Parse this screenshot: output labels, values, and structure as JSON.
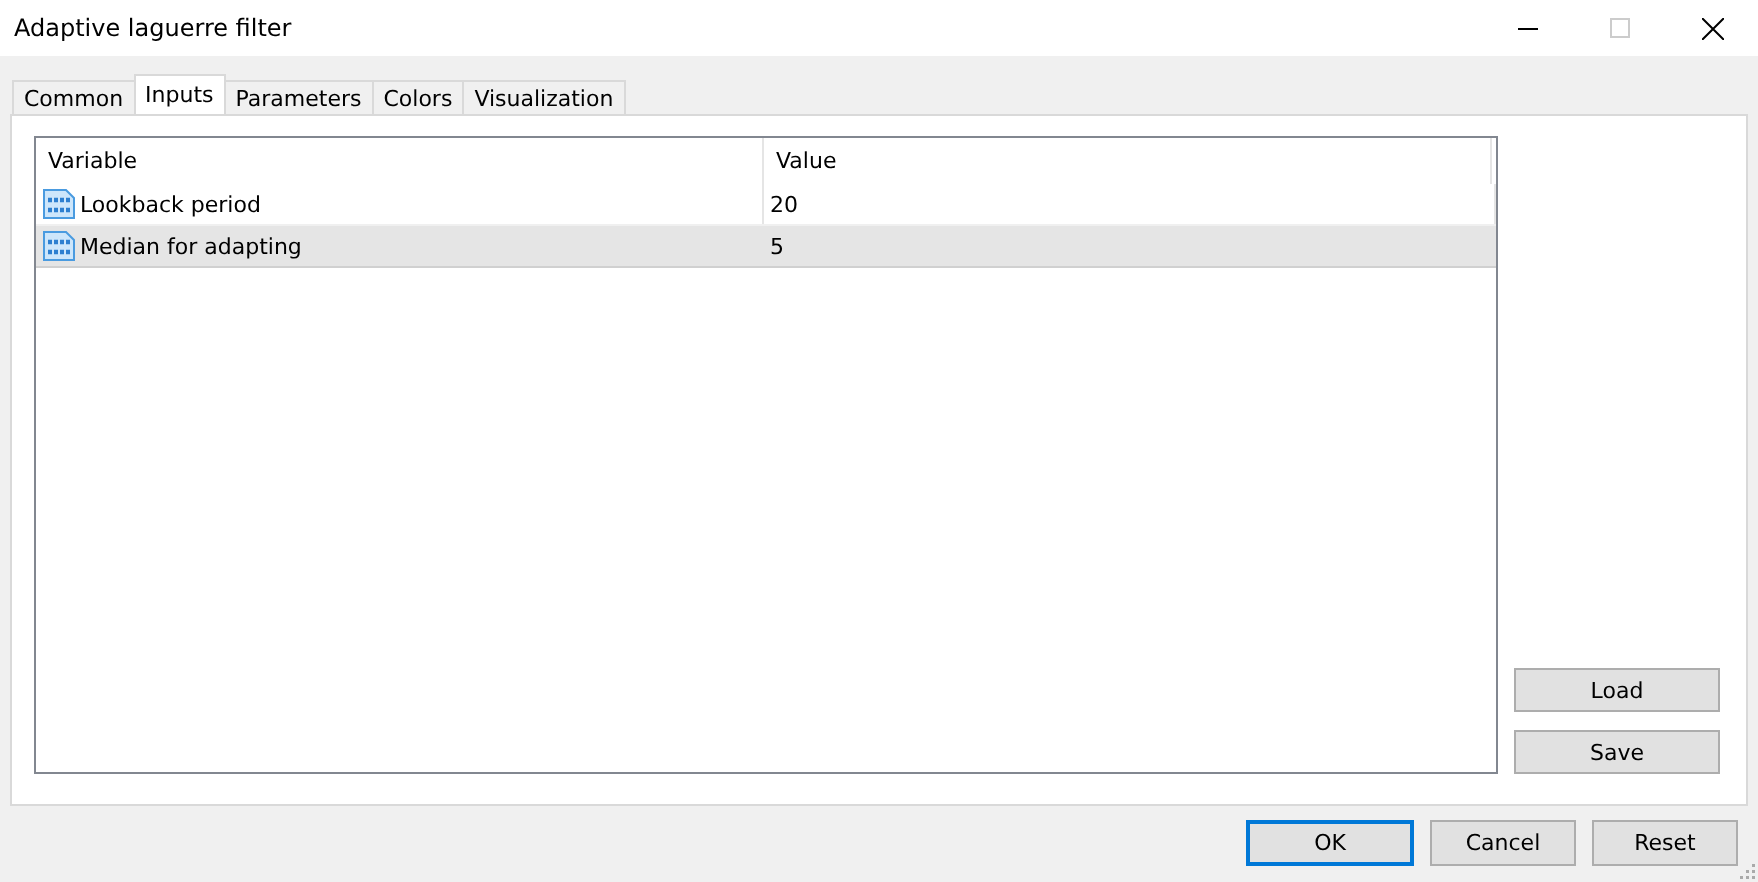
{
  "window": {
    "title": "Adaptive laguerre filter"
  },
  "tabs": [
    {
      "label": "Common",
      "selected": false
    },
    {
      "label": "Inputs",
      "selected": true
    },
    {
      "label": "Parameters",
      "selected": false
    },
    {
      "label": "Colors",
      "selected": false
    },
    {
      "label": "Visualization",
      "selected": false
    }
  ],
  "table": {
    "columns": [
      "Variable",
      "Value"
    ],
    "rows": [
      {
        "variable": "Lookback period",
        "value": "20",
        "selected": false
      },
      {
        "variable": "Median for adapting",
        "value": "5",
        "selected": true
      }
    ]
  },
  "side_buttons": [
    "Load",
    "Save"
  ],
  "buttons": [
    {
      "label": "OK",
      "default": true
    },
    {
      "label": "Cancel",
      "default": false
    },
    {
      "label": "Reset",
      "default": false
    }
  ]
}
